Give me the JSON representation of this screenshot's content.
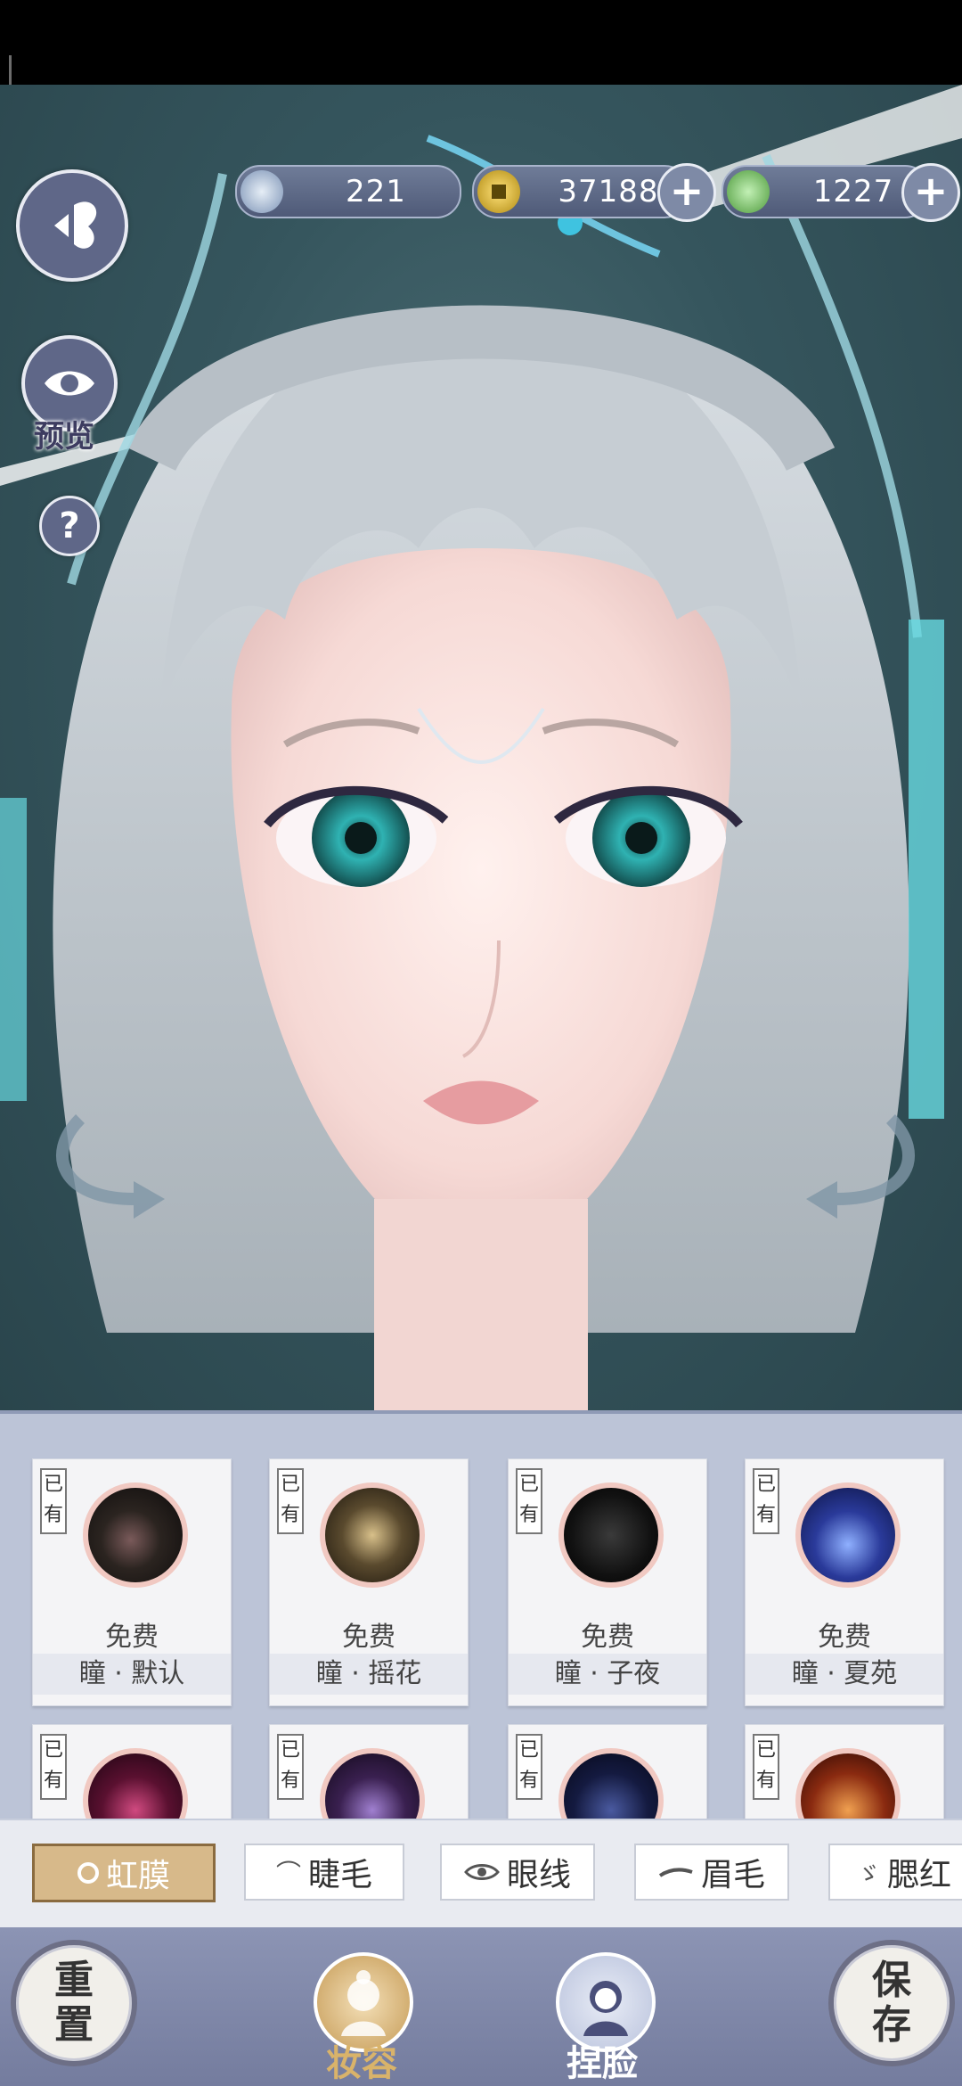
{
  "currencies": [
    {
      "name": "jade",
      "value": "221"
    },
    {
      "name": "coin",
      "value": "37188"
    },
    {
      "name": "gem",
      "value": "1227"
    }
  ],
  "side": {
    "preview_label": "预览",
    "help_label": "?"
  },
  "items": [
    {
      "tag": "已有",
      "price": "免费",
      "name": "瞳 · 默认",
      "color": "#2b2420"
    },
    {
      "tag": "已有",
      "price": "免费",
      "name": "瞳 · 摇花",
      "color": "#5a4a2e"
    },
    {
      "tag": "已有",
      "price": "免费",
      "name": "瞳 · 子夜",
      "color": "#111111"
    },
    {
      "tag": "已有",
      "price": "免费",
      "name": "瞳 · 夏苑",
      "color": "#2a3a9a"
    },
    {
      "tag": "已有",
      "color": "#5a1030"
    },
    {
      "tag": "已有",
      "color": "#3a2050"
    },
    {
      "tag": "已有",
      "color": "#141a40"
    },
    {
      "tag": "已有",
      "color": "#8a2a10"
    }
  ],
  "tabs": [
    {
      "label": "虹膜",
      "icon": "iris-icon",
      "active": true
    },
    {
      "label": "睫毛",
      "icon": "eyelash-icon"
    },
    {
      "label": "眼线",
      "icon": "eyeliner-icon"
    },
    {
      "label": "眉毛",
      "icon": "eyebrow-icon"
    },
    {
      "label": "腮红",
      "icon": "blush-icon"
    }
  ],
  "bottom": {
    "reset_label": "重置",
    "makeup_label": "妆容",
    "face_label": "捏脸",
    "save_label": "保存"
  }
}
